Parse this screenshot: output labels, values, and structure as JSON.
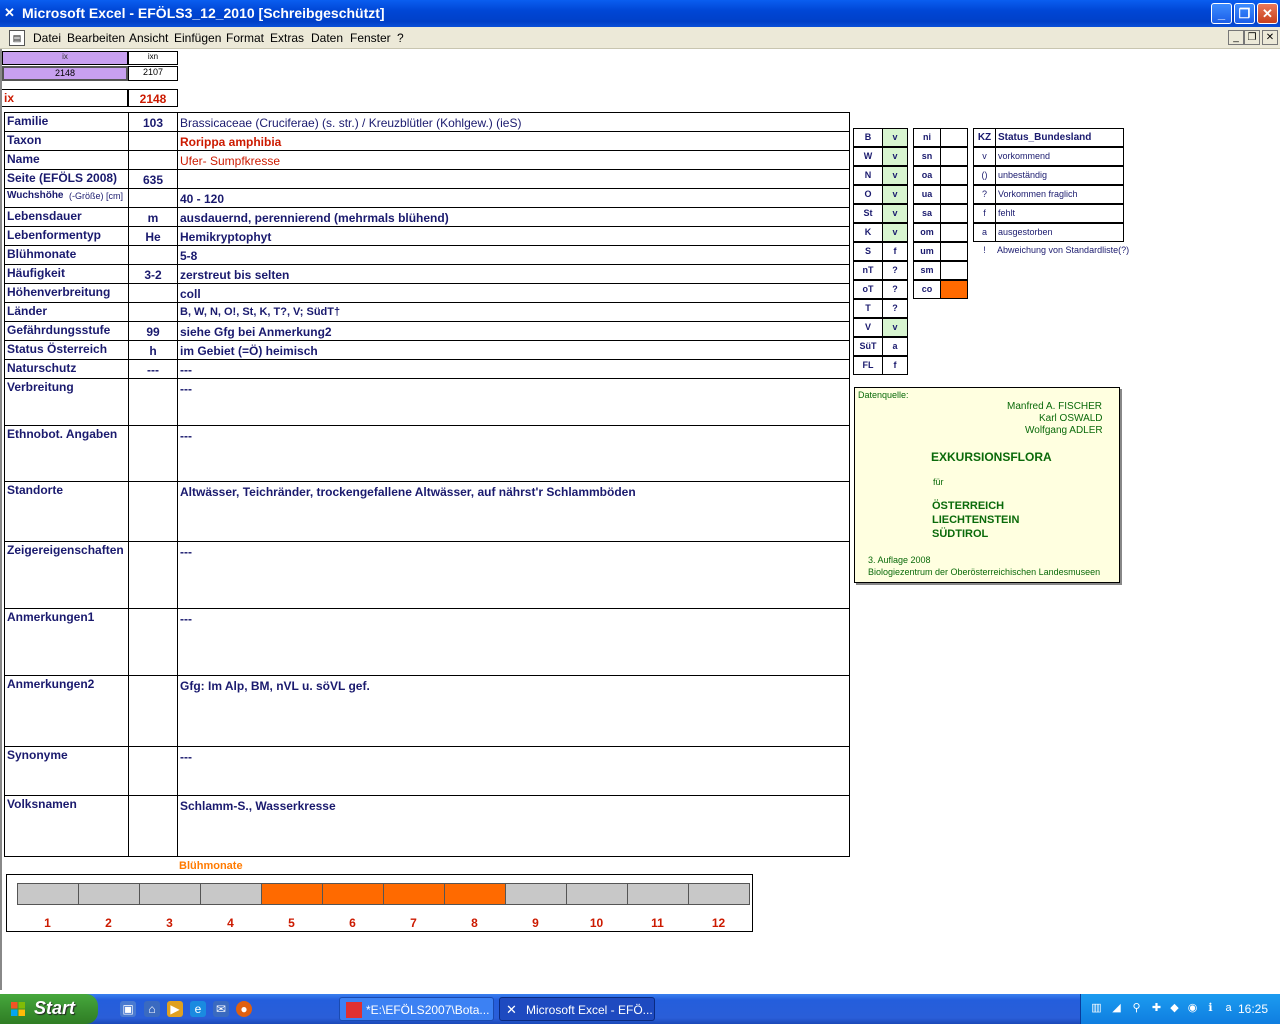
{
  "window": {
    "title": "Microsoft Excel - EFÖLS3_12_2010  [Schreibgeschützt]"
  },
  "menu": [
    "Datei",
    "Bearbeiten",
    "Ansicht",
    "Einfügen",
    "Format",
    "Extras",
    "Daten",
    "Fenster",
    "?"
  ],
  "top_cells": {
    "ix_head": "ix",
    "ixn_head": "ixn",
    "ix_val": "2148",
    "ixn_val": "2107"
  },
  "ix_row": {
    "label": "ix",
    "value": "2148"
  },
  "rows": [
    {
      "label": "Familie",
      "code": "103",
      "value": "Brassicaceae (Cruciferae) (s. str.)  /  Kreuzblütler (Kohlgew.) (ieS)"
    },
    {
      "label": "Taxon",
      "code": "",
      "value": "Rorippa amphibia"
    },
    {
      "label": "Name",
      "code": "",
      "value": "Ufer- Sumpfkresse"
    },
    {
      "label": "Seite (EFÖLS 2008)",
      "code": "635",
      "value": ""
    },
    {
      "label": "Wuchshöhe",
      "label_suffix": "(-Größe) [cm]",
      "code": "",
      "value": "40 - 120"
    },
    {
      "label": "Lebensdauer",
      "code": "m",
      "value": "ausdauernd, perennierend (mehrmals blühend)"
    },
    {
      "label": "Lebenformentyp",
      "code": "He",
      "value": "Hemikryptophyt"
    },
    {
      "label": "Blühmonate",
      "code": "",
      "value": "5-8"
    },
    {
      "label": "Häufigkeit",
      "code": "3-2",
      "value": "zerstreut bis selten"
    },
    {
      "label": "Höhenverbreitung",
      "code": "",
      "value": "coll"
    },
    {
      "label": "Länder",
      "code": "",
      "value": "B, W, N, O!, St, K, T?, V; SüdT†"
    },
    {
      "label": "Gefährdungsstufe",
      "code": "99",
      "value": "siehe Gfg bei Anmerkung2"
    },
    {
      "label": "Status Österreich",
      "code": "h",
      "value": "im Gebiet (=Ö) heimisch"
    },
    {
      "label": "Naturschutz",
      "code": "---",
      "value": "---"
    },
    {
      "label": "Verbreitung",
      "code": "",
      "value": "---"
    },
    {
      "label": "Ethnobot. Angaben",
      "code": "",
      "value": "---"
    },
    {
      "label": "Standorte",
      "code": "",
      "value": "Altwässer, Teichränder, trockengefallene Altwässer, auf nährst'r Schlammböden"
    },
    {
      "label": "Zeigereigenschaften",
      "code": "",
      "value": "---"
    },
    {
      "label": "Anmerkungen1",
      "code": "",
      "value": "---"
    },
    {
      "label": "Anmerkungen2",
      "code": "",
      "value": "Gfg: Im Alp, BM, nVL u. söVL gef."
    },
    {
      "label": "Synonyme",
      "code": "",
      "value": "---"
    },
    {
      "label": "Volksnamen",
      "code": "",
      "value": "Schlamm-S., Wasserkresse"
    }
  ],
  "states": [
    {
      "code": "B",
      "status": "v",
      "green": true
    },
    {
      "code": "W",
      "status": "v",
      "green": true
    },
    {
      "code": "N",
      "status": "v",
      "green": true
    },
    {
      "code": "O",
      "status": "v",
      "green": true
    },
    {
      "code": "St",
      "status": "v",
      "green": true
    },
    {
      "code": "K",
      "status": "v",
      "green": true
    },
    {
      "code": "S",
      "status": "f",
      "green": false
    },
    {
      "code": "nT",
      "status": "?",
      "green": false
    },
    {
      "code": "oT",
      "status": "?",
      "green": false
    },
    {
      "code": "T",
      "status": "?",
      "green": false
    },
    {
      "code": "V",
      "status": "v",
      "green": true
    },
    {
      "code": "SüT",
      "status": "a",
      "green": false
    },
    {
      "code": "FL",
      "status": "f",
      "green": false
    }
  ],
  "altitude": [
    {
      "code": "ni",
      "mark": false
    },
    {
      "code": "sn",
      "mark": false
    },
    {
      "code": "oa",
      "mark": false
    },
    {
      "code": "ua",
      "mark": false
    },
    {
      "code": "sa",
      "mark": false
    },
    {
      "code": "om",
      "mark": false
    },
    {
      "code": "um",
      "mark": false
    },
    {
      "code": "sm",
      "mark": false
    },
    {
      "code": "co",
      "mark": true
    }
  ],
  "legend": {
    "head_kz": "KZ",
    "head_status": "Status_Bundesland",
    "items": [
      {
        "kz": "v",
        "text": "vorkommend"
      },
      {
        "kz": "()",
        "text": "unbeständig"
      },
      {
        "kz": "?",
        "text": "Vorkommen fraglich"
      },
      {
        "kz": "f",
        "text": "fehlt"
      },
      {
        "kz": "a",
        "text": "ausgestorben"
      },
      {
        "kz": "!",
        "text": "Abweichung von Standardliste(?)"
      }
    ]
  },
  "source": {
    "label": "Datenquelle:",
    "author1": "Manfred A. FISCHER",
    "author2": "Karl OSWALD",
    "author3": "Wolfgang ADLER",
    "book": "EXKURSIONSFLORA",
    "fuer": "für",
    "country1": "ÖSTERREICH",
    "country2": "LIECHTENSTEIN",
    "country3": "SÜDTIROL",
    "edition": "3. Auflage 2008",
    "publisher": "Biologiezentrum der Oberösterreichischen Landesmuseen"
  },
  "bloom": {
    "title": "Blühmonate",
    "months": [
      "1",
      "2",
      "3",
      "4",
      "5",
      "6",
      "7",
      "8",
      "9",
      "10",
      "11",
      "12"
    ],
    "active": [
      false,
      false,
      false,
      false,
      true,
      true,
      true,
      true,
      false,
      false,
      false,
      false
    ]
  },
  "taskbar": {
    "start": "Start",
    "tasks": [
      "*E:\\EFÖLS2007\\Bota...",
      "Microsoft Excel - EFÖ..."
    ],
    "clock": "16:25"
  },
  "colors": {
    "accent_orange": "#ff6a00",
    "label_blue": "#1a1a6e",
    "red": "#cc1a00",
    "green": "#d8f5d0"
  }
}
